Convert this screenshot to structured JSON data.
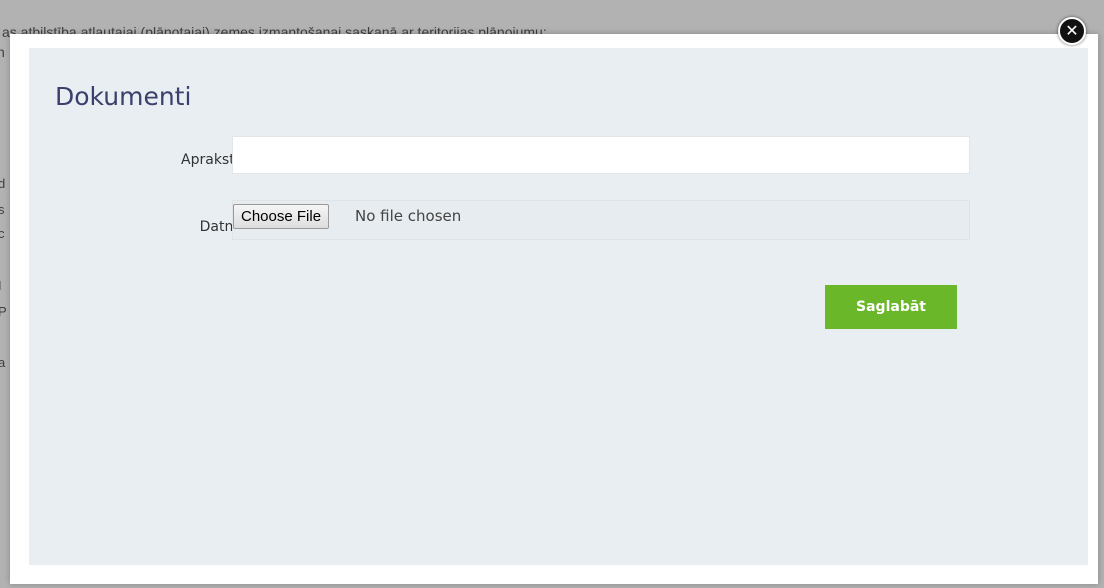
{
  "background": {
    "line1": "as atbilstība atļautajai (plānotajai) zemes izmantošanai saskaņā ar teritorijas plānojumu:",
    "line2": "n",
    "fragments": [
      "d",
      "s",
      "c",
      "I",
      "P",
      "a"
    ]
  },
  "modal": {
    "title": "Dokumenti",
    "close_label": "✕",
    "fields": {
      "apraksts_label": "Apraksts",
      "apraksts_value": "",
      "datne_label": "Datne",
      "choose_file_label": "Choose File",
      "file_status": "No file chosen"
    },
    "save_label": "Saglabāt"
  },
  "colors": {
    "accent": "#6ab82a",
    "title": "#3a3f6b",
    "panel": "#e8eef2"
  }
}
